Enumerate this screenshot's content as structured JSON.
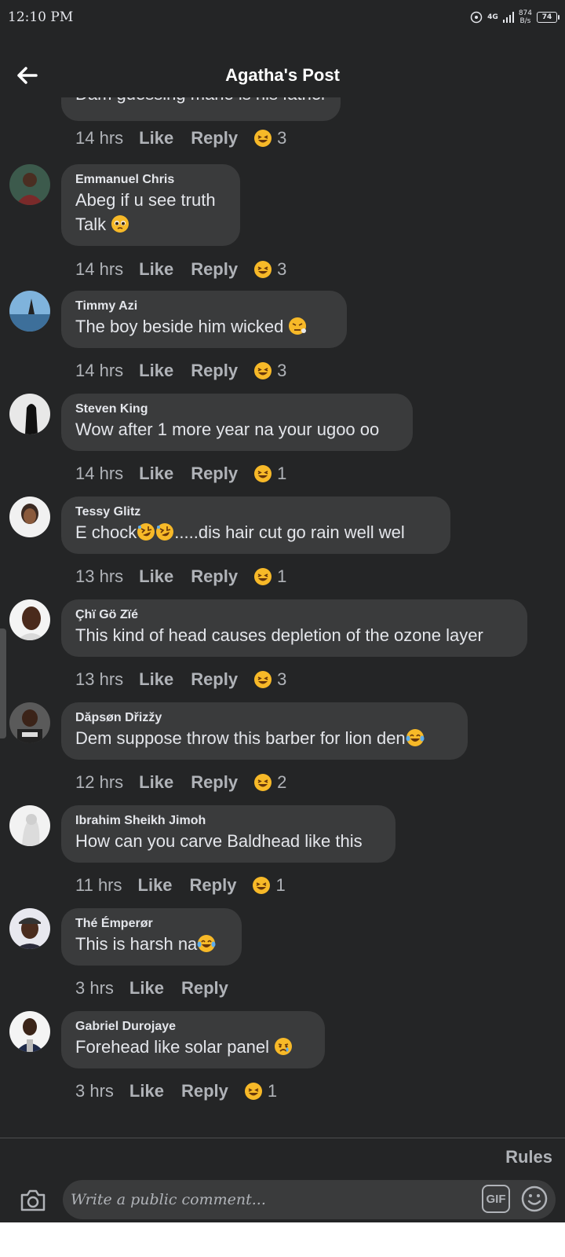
{
  "status": {
    "time": "12:10 PM",
    "network": "4G",
    "speed_top": "874",
    "speed_bottom": "B/s",
    "battery": "74"
  },
  "header": {
    "title": "Agatha's Post"
  },
  "comments": [
    {
      "author": "",
      "text": "Dam guessing mane is his father",
      "time": "14 hrs",
      "like": "Like",
      "reply": "Reply",
      "reactions": "3"
    },
    {
      "author": "Emmanuel Chris",
      "text": "Abeg if u see truth\nTalk",
      "time": "14 hrs",
      "like": "Like",
      "reply": "Reply",
      "reactions": "3"
    },
    {
      "author": "Timmy Azi",
      "text": "The boy beside him wicked",
      "time": "14 hrs",
      "like": "Like",
      "reply": "Reply",
      "reactions": "3"
    },
    {
      "author": "Steven King",
      "text": "Wow after 1 more year na your ugoo oo",
      "time": "14 hrs",
      "like": "Like",
      "reply": "Reply",
      "reactions": "1"
    },
    {
      "author": "Tessy Glitz",
      "text": "E chock",
      "text_after": ".....dis hair cut go rain well wel",
      "time": "13 hrs",
      "like": "Like",
      "reply": "Reply",
      "reactions": "1"
    },
    {
      "author": "Çhï Gö Zïé",
      "text": "This kind of head causes depletion of the ozone layer",
      "time": "13 hrs",
      "like": "Like",
      "reply": "Reply",
      "reactions": "3"
    },
    {
      "author": "Dăpsøn Dřizžy",
      "text": "Dem suppose throw this barber for lion den",
      "time": "12 hrs",
      "like": "Like",
      "reply": "Reply",
      "reactions": "2"
    },
    {
      "author": "Ibrahim Sheikh Jimoh",
      "text": "How can you carve Baldhead like this",
      "time": "11 hrs",
      "like": "Like",
      "reply": "Reply",
      "reactions": "1"
    },
    {
      "author": "Thé Émperør",
      "text": "This is harsh na",
      "time": "3 hrs",
      "like": "Like",
      "reply": "Reply",
      "reactions": ""
    },
    {
      "author": "Gabriel Durojaye",
      "text": "Forehead like solar panel",
      "time": "3 hrs",
      "like": "Like",
      "reply": "Reply",
      "reactions": "1"
    }
  ],
  "footer": {
    "rules": "Rules",
    "placeholder": "Write a public comment...",
    "gif": "GIF"
  },
  "colors": {
    "background": "#242526",
    "bubble": "#3a3b3c",
    "muted_text": "#b0b3b8",
    "emoji_yellow": "#f7b928"
  },
  "icons": {
    "back": "arrow-left-icon",
    "camera": "camera-icon",
    "gif": "gif-icon",
    "emoji": "smiley-icon",
    "reaction": "haha-reaction-icon"
  }
}
